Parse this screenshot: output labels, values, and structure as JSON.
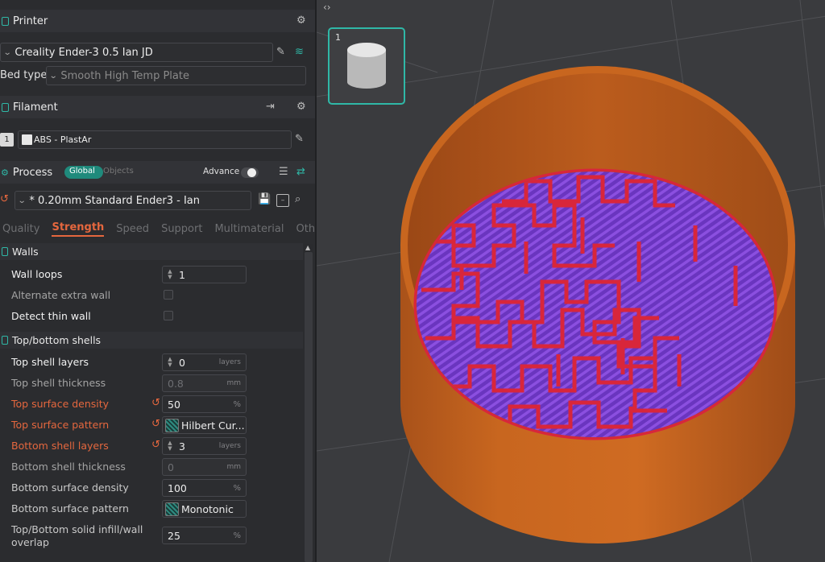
{
  "printer": {
    "title": "Printer",
    "name": "Creality Ender-3 0.5 Ian JD",
    "bed_label": "Bed type",
    "bed_value": "Smooth High Temp Plate"
  },
  "filament": {
    "title": "Filament",
    "slot": "1",
    "name": "ABS - PlastAr"
  },
  "process": {
    "title": "Process",
    "global_label": "Global",
    "objects_label": "Objects",
    "advance_label": "Advance",
    "preset": "* 0.20mm Standard Ender3 - Ian"
  },
  "tabs": [
    "Quality",
    "Strength",
    "Speed",
    "Support",
    "Multimaterial",
    "Others"
  ],
  "walls": {
    "title": "Walls",
    "wall_loops_label": "Wall loops",
    "wall_loops_value": "1",
    "alt_extra_wall_label": "Alternate extra wall",
    "detect_thin_wall_label": "Detect thin wall"
  },
  "shells": {
    "title": "Top/bottom shells",
    "top_layers_label": "Top shell layers",
    "top_layers_value": "0",
    "top_thickness_label": "Top shell thickness",
    "top_thickness_value": "0.8",
    "top_density_label": "Top surface density",
    "top_density_value": "50",
    "top_pattern_label": "Top surface pattern",
    "top_pattern_value": "Hilbert Cur...",
    "bottom_layers_label": "Bottom shell layers",
    "bottom_layers_value": "3",
    "bottom_thickness_label": "Bottom shell thickness",
    "bottom_thickness_value": "0",
    "bottom_density_label": "Bottom surface density",
    "bottom_density_value": "100",
    "bottom_pattern_label": "Bottom surface pattern",
    "bottom_pattern_value": "Monotonic",
    "solid_infill_overlap_label_1": "Top/Bottom solid infill/wall",
    "solid_infill_overlap_label_2": "overlap",
    "solid_infill_overlap_value": "25"
  },
  "units": {
    "layers": "layers",
    "mm": "mm",
    "percent": "%"
  },
  "viewport": {
    "plate_number": "1",
    "collapse_icon": "chevron-collapse-icon"
  },
  "colors": {
    "accent": "#2fb8a7",
    "modified": "#e5673e",
    "wall": "#c8661f",
    "top_surface": "#d8263b",
    "infill": "#7a3fd0"
  }
}
